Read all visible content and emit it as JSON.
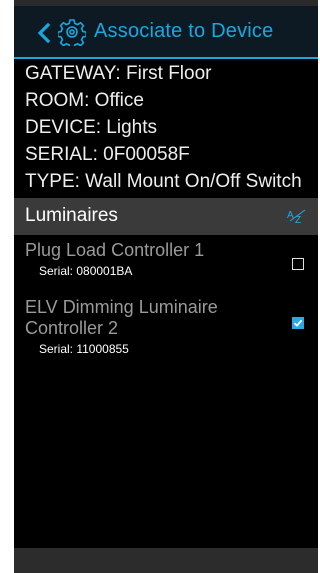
{
  "header": {
    "title": "Associate to Device"
  },
  "info": {
    "gateway": "GATEWAY: First Floor",
    "room": "ROOM: Office",
    "device": "DEVICE: Lights",
    "serial": "SERIAL: 0F00058F",
    "type": "TYPE: Wall Mount On/Off Switch"
  },
  "section": {
    "label": "Luminaires",
    "sort_icon": "az-sort-icon"
  },
  "items": [
    {
      "name_line1": "Plug Load Controller 1",
      "name_line2": "",
      "serial": "Serial:  080001BA",
      "checked": false
    },
    {
      "name_line1": "ELV Dimming Luminaire",
      "name_line2": "Controller 2",
      "serial": "Serial:  11000855",
      "checked": true
    }
  ],
  "colors": {
    "accent": "#18a8e0",
    "header_bg": "#0e1a23",
    "section_bg": "#3a3a3a",
    "checkbox_checked": "#2aa8e8"
  }
}
